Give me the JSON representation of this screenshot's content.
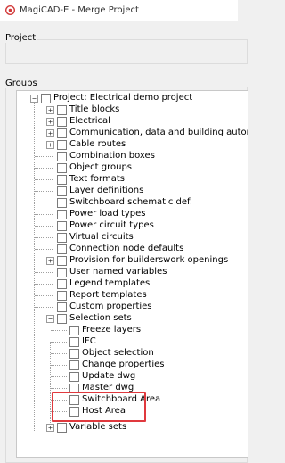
{
  "window": {
    "title": "MagiCAD-E - Merge Project"
  },
  "project_group": {
    "label": "Project"
  },
  "groups_group": {
    "label": "Groups"
  },
  "tree": {
    "root": "Project: Electrical demo project",
    "level1": [
      "Title blocks",
      "Electrical",
      "Communication, data and building automation",
      "Cable routes",
      "Combination boxes",
      "Object groups",
      "Text formats",
      "Layer definitions",
      "Switchboard schematic def.",
      "Power load types",
      "Power circuit types",
      "Virtual circuits",
      "Connection node defaults",
      "Provision for builderswork openings",
      "User named variables",
      "Legend templates",
      "Report templates",
      "Custom properties",
      "Selection sets"
    ],
    "selection_sets_children": [
      "Freeze layers",
      "IFC",
      "Object selection",
      "Change properties",
      "Update dwg",
      "Master dwg",
      "Switchboard Area",
      "Host Area"
    ],
    "last": "Variable sets"
  },
  "colors": {
    "highlight": "#e0393e"
  }
}
